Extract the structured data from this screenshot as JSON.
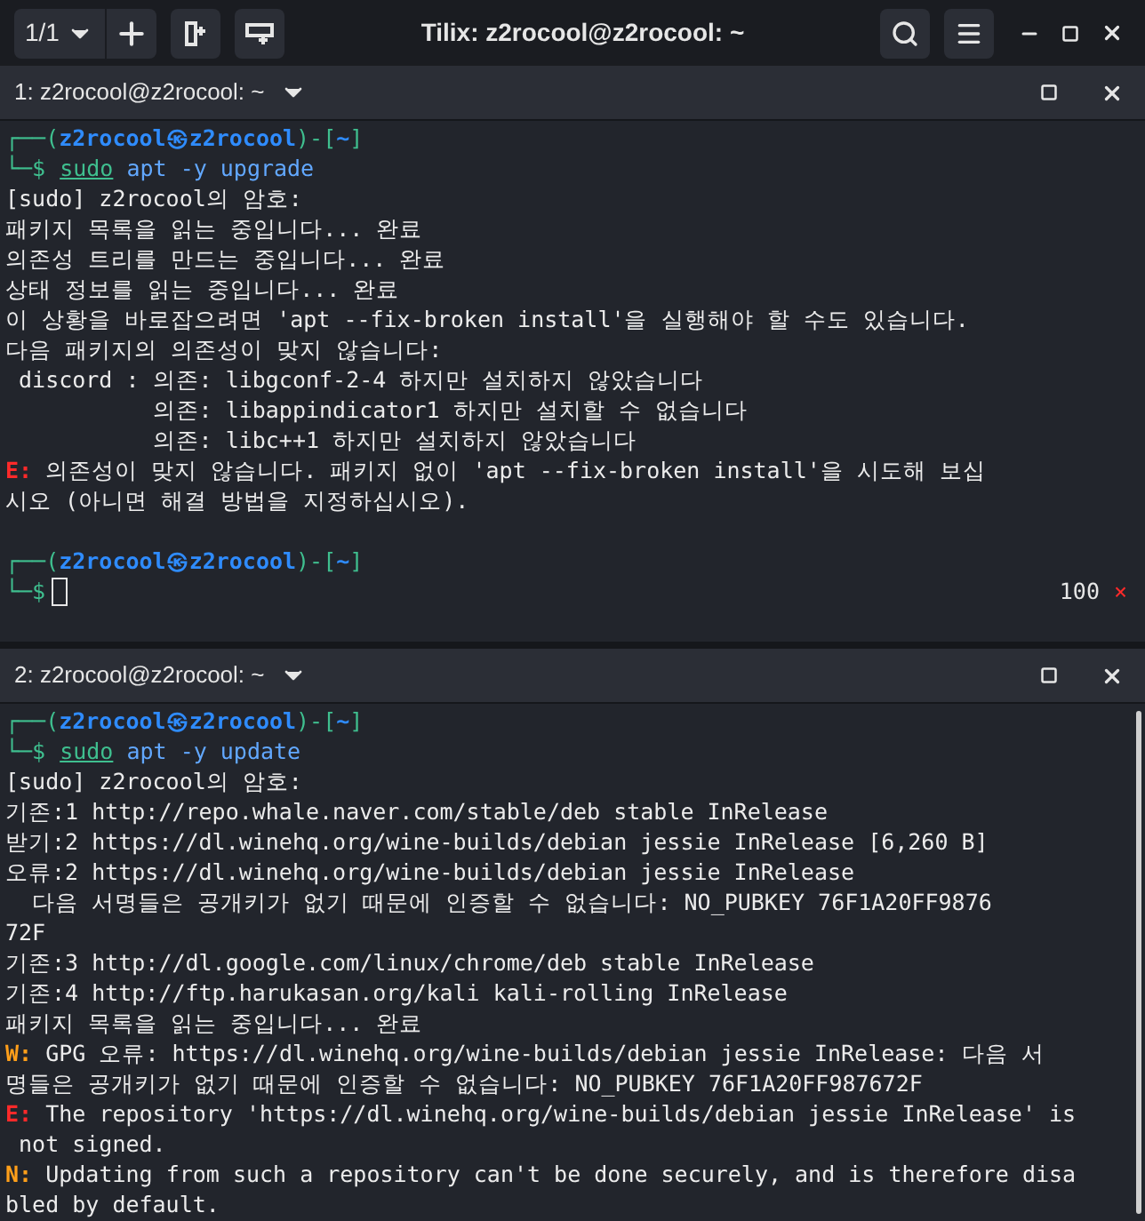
{
  "title_bar": {
    "pager": "1/1",
    "title": "Tilix: z2rocool@z2rocool: ~"
  },
  "panes": [
    {
      "title": "1: z2rocool@z2rocool: ~",
      "scrollbar": false,
      "lines": [
        {
          "kind": "prompt",
          "parts": [
            "┌──(",
            "z2rocool㉿z2rocool",
            ")-[",
            "~",
            "]"
          ]
        },
        {
          "kind": "command",
          "marker": "└─$",
          "program": "sudo",
          "args": "apt -y upgrade"
        },
        {
          "kind": "text",
          "text": "[sudo] z2rocool의 암호:"
        },
        {
          "kind": "text",
          "text": "패키지 목록을 읽는 중입니다... 완료"
        },
        {
          "kind": "text",
          "text": "의존성 트리를 만드는 중입니다... 완료"
        },
        {
          "kind": "text",
          "text": "상태 정보를 읽는 중입니다... 완료"
        },
        {
          "kind": "text",
          "text": "이 상황을 바로잡으려면 'apt --fix-broken install'을 실행해야 할 수도 있습니다."
        },
        {
          "kind": "text",
          "text": "다음 패키지의 의존성이 맞지 않습니다:"
        },
        {
          "kind": "text",
          "text": " discord : 의존: libgconf-2-4 하지만 설치하지 않았습니다"
        },
        {
          "kind": "text",
          "text": "           의존: libappindicator1 하지만 설치할 수 없습니다"
        },
        {
          "kind": "text",
          "text": "           의존: libc++1 하지만 설치하지 않았습니다"
        },
        {
          "kind": "tagged",
          "tag": "E:",
          "color": "#ff2a2a",
          "text": " 의존성이 맞지 않습니다. 패키지 없이 'apt --fix-broken install'을 시도해 보십"
        },
        {
          "kind": "text",
          "text": "시오 (아니면 해결 방법을 지정하십시오)."
        },
        {
          "kind": "blank"
        },
        {
          "kind": "prompt",
          "parts": [
            "┌──(",
            "z2rocool㉿z2rocool",
            ")-[",
            "~",
            "]"
          ]
        },
        {
          "kind": "input",
          "marker": "└─$",
          "exit_code": "100",
          "exit_mark": "×"
        }
      ]
    },
    {
      "title": "2: z2rocool@z2rocool: ~",
      "scrollbar": true,
      "lines": [
        {
          "kind": "prompt",
          "parts": [
            "┌──(",
            "z2rocool㉿z2rocool",
            ")-[",
            "~",
            "]"
          ]
        },
        {
          "kind": "command",
          "marker": "└─$",
          "program": "sudo",
          "args": "apt -y update"
        },
        {
          "kind": "text",
          "text": "[sudo] z2rocool의 암호:"
        },
        {
          "kind": "text",
          "text": "기존:1 http://repo.whale.naver.com/stable/deb stable InRelease"
        },
        {
          "kind": "text",
          "text": "받기:2 https://dl.winehq.org/wine-builds/debian jessie InRelease [6,260 B]"
        },
        {
          "kind": "text",
          "text": "오류:2 https://dl.winehq.org/wine-builds/debian jessie InRelease"
        },
        {
          "kind": "text",
          "text": "  다음 서명들은 공개키가 없기 때문에 인증할 수 없습니다: NO_PUBKEY 76F1A20FF9876"
        },
        {
          "kind": "text",
          "text": "72F"
        },
        {
          "kind": "text",
          "text": "기존:3 http://dl.google.com/linux/chrome/deb stable InRelease"
        },
        {
          "kind": "text",
          "text": "기존:4 http://ftp.harukasan.org/kali kali-rolling InRelease"
        },
        {
          "kind": "text",
          "text": "패키지 목록을 읽는 중입니다... 완료"
        },
        {
          "kind": "tagged",
          "tag": "W:",
          "color": "#ff9f1a",
          "text": " GPG 오류: https://dl.winehq.org/wine-builds/debian jessie InRelease: 다음 서"
        },
        {
          "kind": "text",
          "text": "명들은 공개키가 없기 때문에 인증할 수 없습니다: NO_PUBKEY 76F1A20FF987672F"
        },
        {
          "kind": "tagged",
          "tag": "E:",
          "color": "#ff2a2a",
          "text": " The repository 'https://dl.winehq.org/wine-builds/debian jessie InRelease' is"
        },
        {
          "kind": "text",
          "text": " not signed."
        },
        {
          "kind": "tagged",
          "tag": "N:",
          "color": "#ff9f1a",
          "text": " Updating from such a repository can't be done securely, and is therefore disa"
        },
        {
          "kind": "text",
          "text": "bled by default."
        }
      ]
    }
  ]
}
